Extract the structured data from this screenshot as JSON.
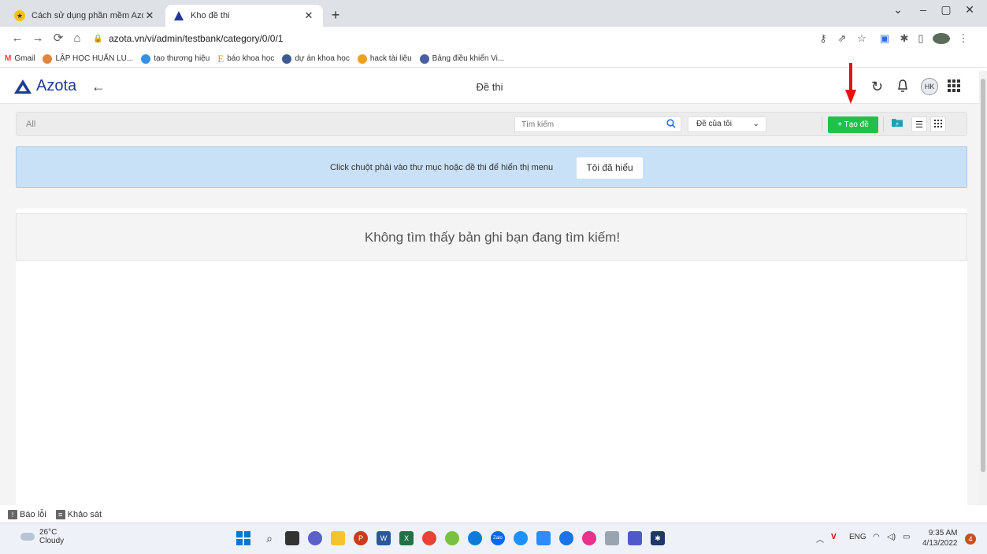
{
  "browser": {
    "tabs": [
      {
        "label": "Cách sử dụng phần mềm Azota |",
        "active": false
      },
      {
        "label": "Kho đề thi",
        "active": true
      }
    ],
    "url": "azota.vn/vi/admin/testbank/category/0/0/1",
    "bookmarks": [
      "Gmail",
      "LẬP HỌC HUẤN LU...",
      "tạo thương hiệu",
      "báo khoa học",
      "dự án khoa học",
      "hack tài liệu",
      "Bảng điều khiển Vi..."
    ]
  },
  "app": {
    "logo_text": "Azota",
    "page_title": "Đề thi",
    "avatar_initials": "HK",
    "brand_color": "#1f3a93"
  },
  "toolbar": {
    "breadcrumb": "All",
    "search_placeholder": "Tìm kiếm",
    "filter_value": "Đề của tôi",
    "create_label": "+ Tạo đề",
    "create_color": "#1ec24a"
  },
  "banner": {
    "message": "Click chuột phải vào thư mục hoặc đề thi để hiển thị menu",
    "button_label": "Tôi đã hiểu"
  },
  "empty_state": {
    "message": "Không tìm thấy bản ghi bạn đang tìm kiếm!"
  },
  "feedback": {
    "report_label": "Báo lỗi",
    "survey_label": "Khảo sát"
  },
  "taskbar": {
    "temperature": "26°C",
    "weather": "Cloudy",
    "language": "ENG",
    "time": "9:35 AM",
    "date": "4/13/2022",
    "notifications": "4"
  }
}
